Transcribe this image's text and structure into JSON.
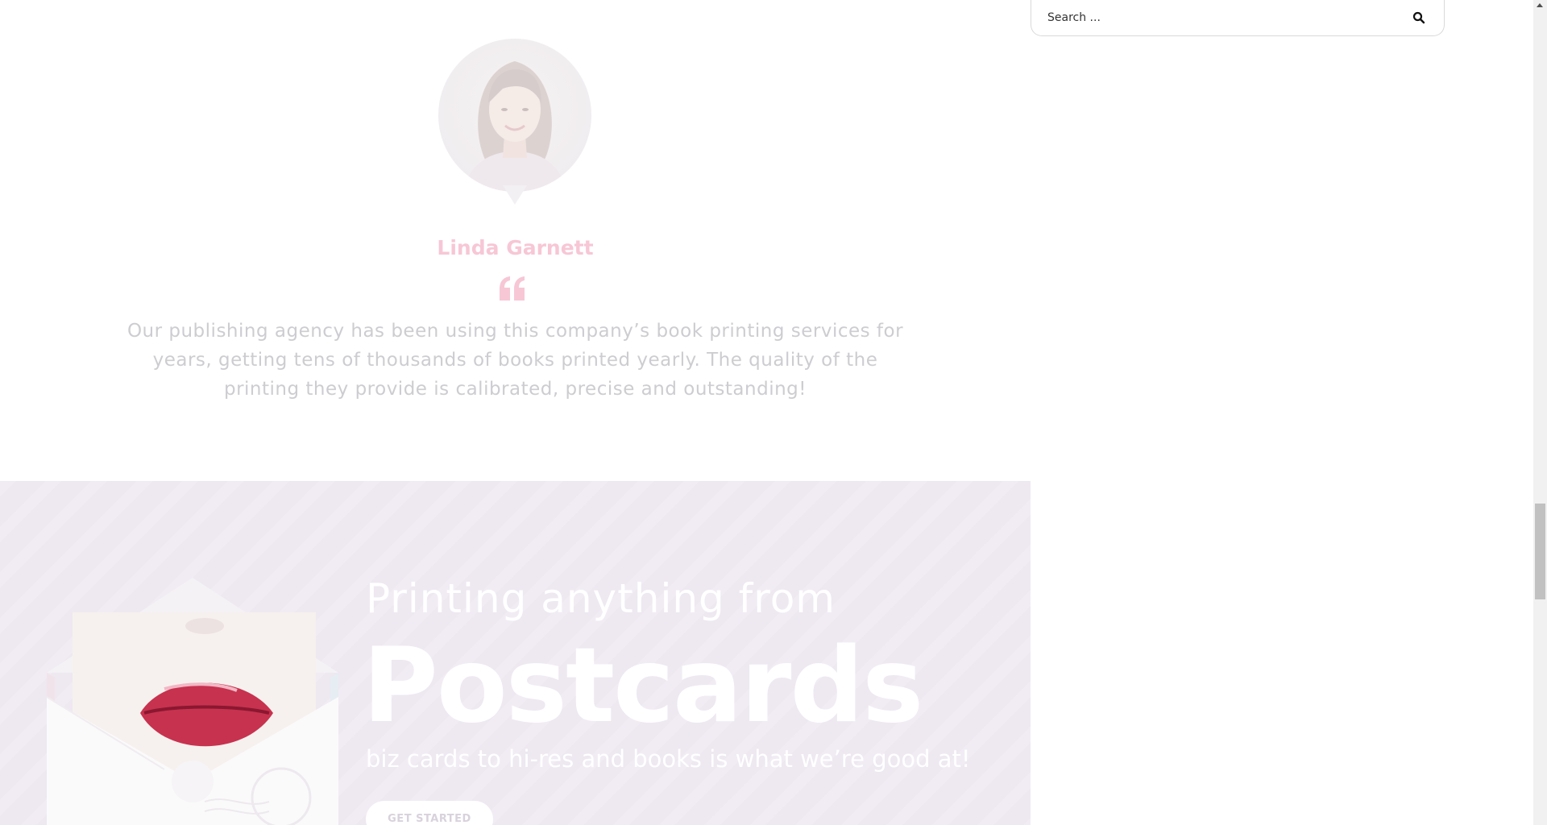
{
  "testimonial": {
    "name": "Linda Garnett",
    "quote": "Our publishing agency has been using this company’s book printing services for years, getting tens of thousands of books printed yearly. The quality of the printing they provide is calibrated, precise and outstanding!"
  },
  "promo": {
    "lead": "Printing anything from",
    "highlight": "Postcards",
    "subtitle": "biz cards to hi-res and books is what we’re good at!",
    "button_label": "GET STARTED"
  },
  "search": {
    "placeholder": "Search ..."
  },
  "colors": {
    "accent_pink": "#f7c7d6",
    "promo_background": "#eee8f1",
    "quote_text": "#cdcdd1"
  },
  "icons": {
    "quote": "quote-icon",
    "search": "search-icon",
    "scroll_up": "chevron-up-icon"
  }
}
